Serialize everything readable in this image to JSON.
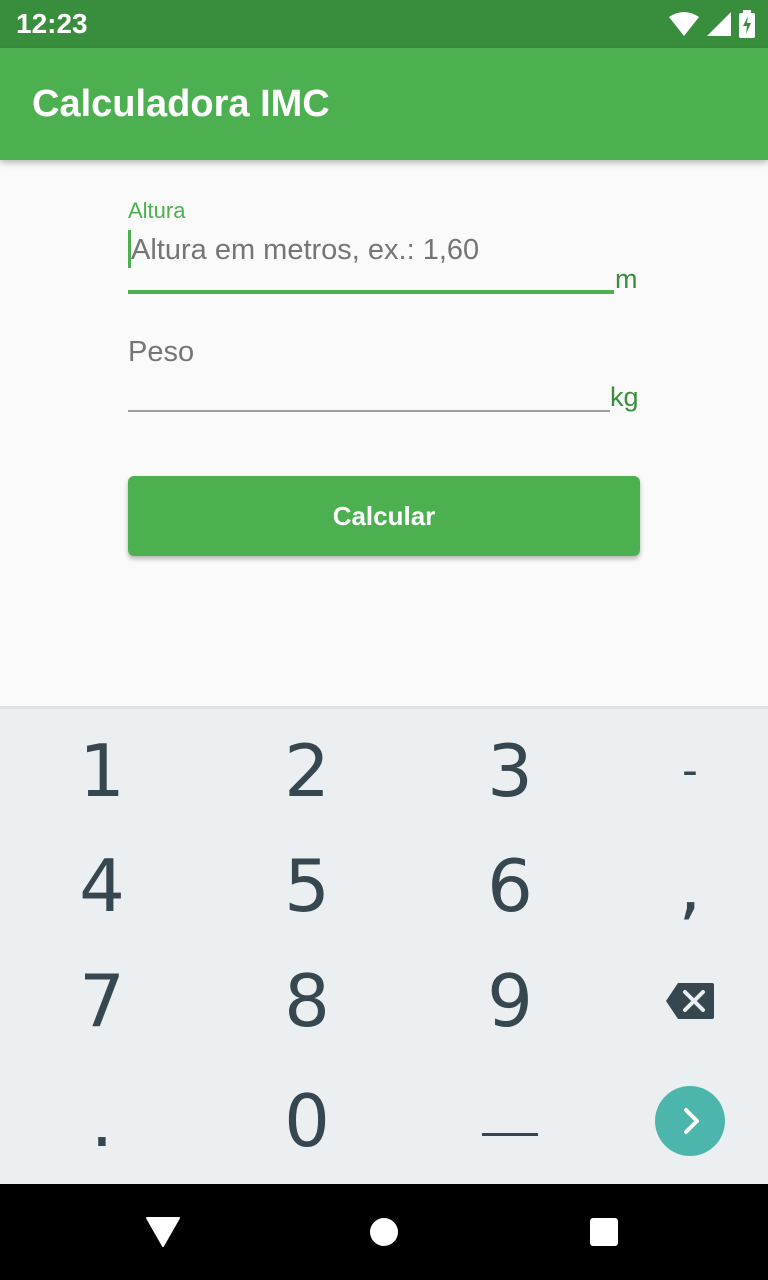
{
  "status_bar": {
    "time": "12:23",
    "icons": [
      "wifi-icon",
      "signal-icon",
      "battery-charging-icon"
    ]
  },
  "app_bar": {
    "title": "Calculadora IMC"
  },
  "form": {
    "altura": {
      "label": "Altura",
      "placeholder": "Altura em metros, ex.: 1,60",
      "value": "",
      "suffix": "m",
      "focused": true
    },
    "peso": {
      "label": "Peso",
      "value": "",
      "suffix": "kg"
    },
    "button_label": "Calcular"
  },
  "keyboard": {
    "rows": [
      [
        "1",
        "2",
        "3",
        "-"
      ],
      [
        "4",
        "5",
        "6",
        ","
      ],
      [
        "7",
        "8",
        "9",
        "backspace-icon"
      ],
      [
        ".",
        "0",
        "space-icon",
        "next-icon"
      ]
    ],
    "accent_color": "#4db6ac"
  },
  "colors": {
    "primary": "#4caf50",
    "primary_dark": "#388e3c",
    "background": "#fafafa"
  },
  "nav_bar": {
    "icons": [
      "back-icon",
      "home-icon",
      "recents-icon"
    ]
  }
}
